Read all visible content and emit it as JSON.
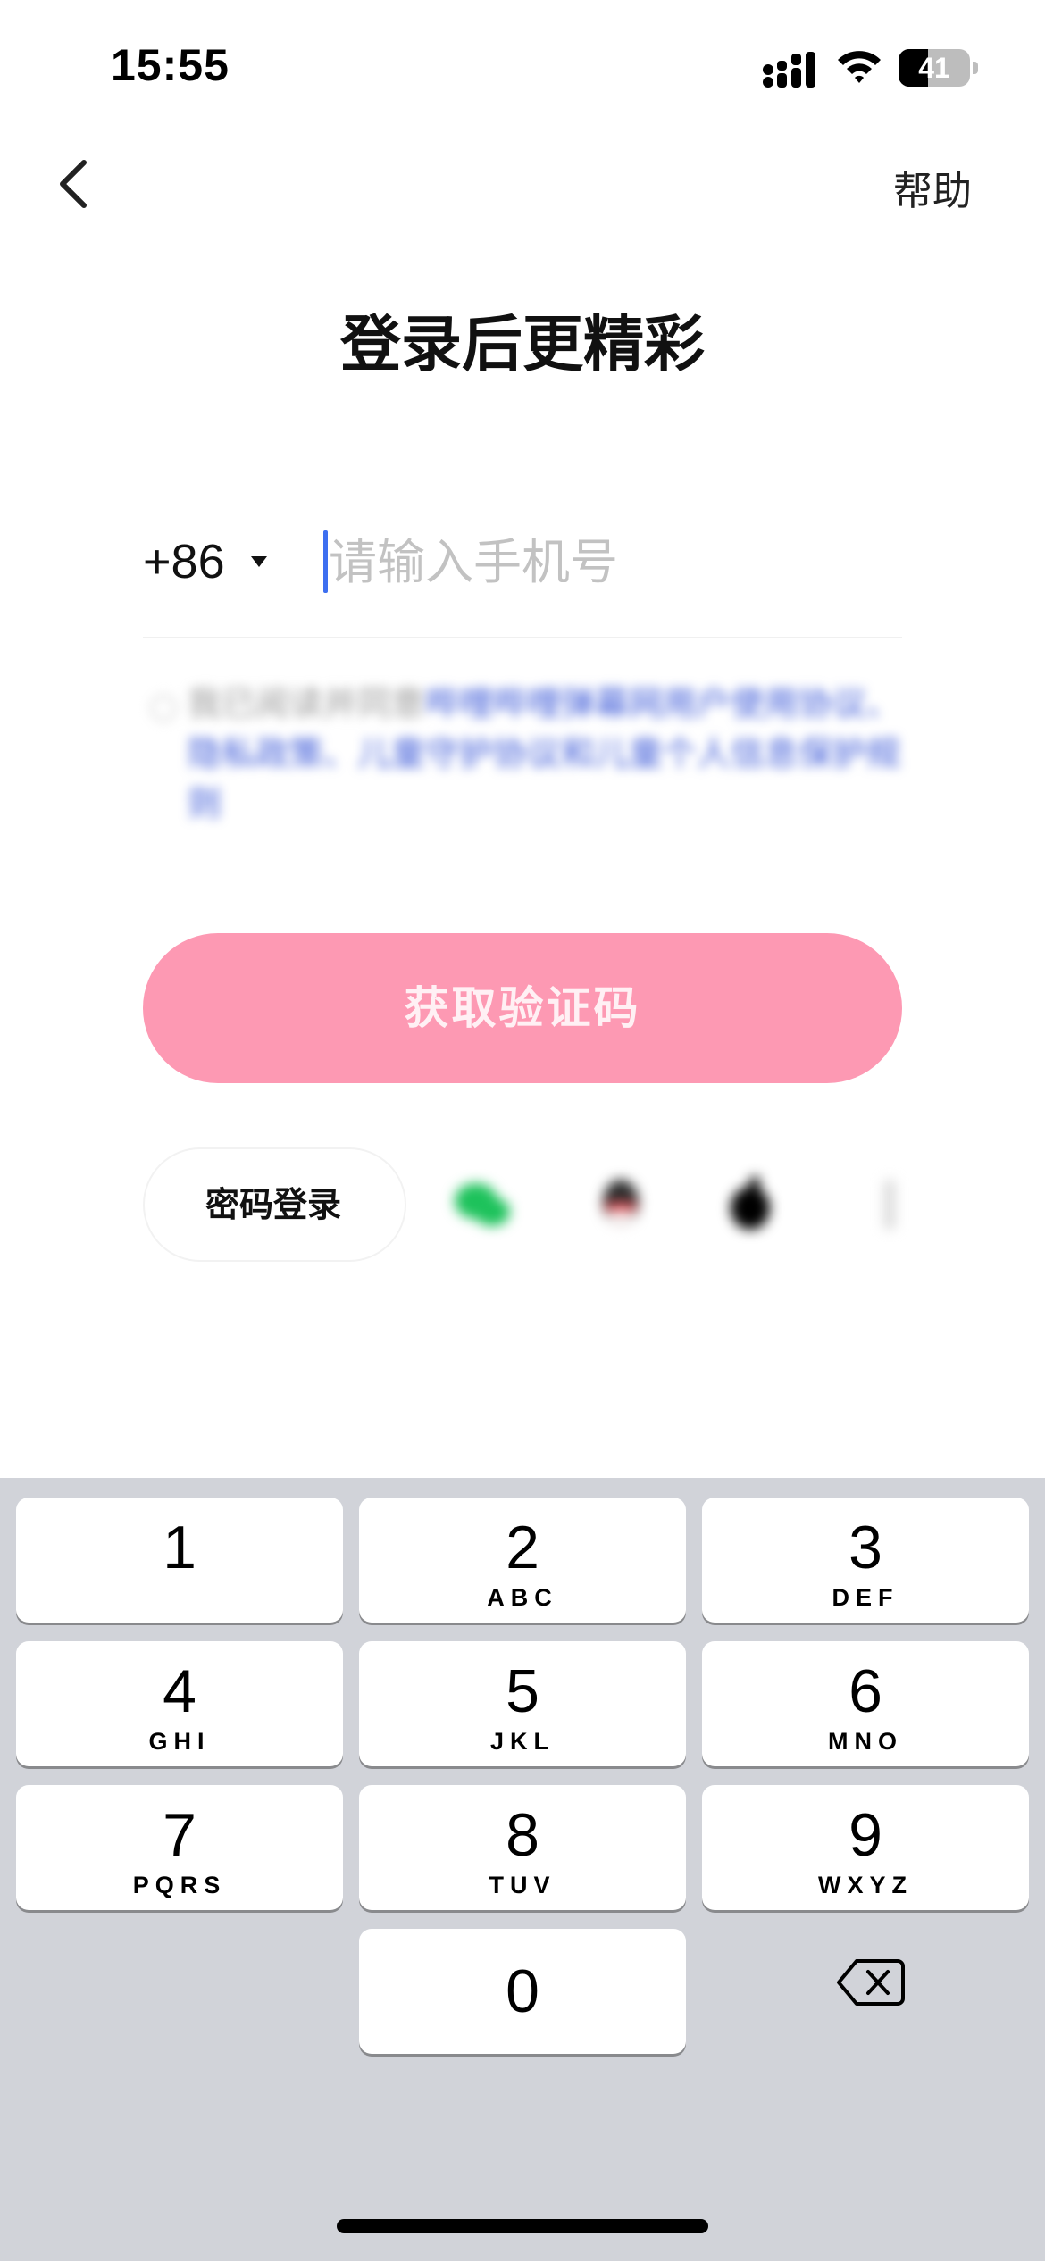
{
  "status_bar": {
    "time": "15:55",
    "battery": "41",
    "battery_level": 0.41
  },
  "nav": {
    "help": "帮助"
  },
  "title": "登录后更精彩",
  "phone": {
    "country_code": "+86",
    "placeholder": "请输入手机号",
    "value": ""
  },
  "agreement": {
    "text_prefix": "我已阅读并同意",
    "links": "哔哩哔哩弹幕网用户使用协议、隐私政策、儿童守护协议和儿童个人信息保护规则"
  },
  "primary_button": "获取验证码",
  "alt_login": {
    "password_login": "密码登录"
  },
  "social_icons": [
    "wechat-icon",
    "qq-icon",
    "apple-icon",
    "more-icon"
  ],
  "colors": {
    "accent_pink": "#fd99b3",
    "caret_blue": "#3d6ff0",
    "keyboard_bg": "#d1d3d9"
  },
  "keypad": [
    {
      "digit": "1",
      "letters": ""
    },
    {
      "digit": "2",
      "letters": "ABC"
    },
    {
      "digit": "3",
      "letters": "DEF"
    },
    {
      "digit": "4",
      "letters": "GHI"
    },
    {
      "digit": "5",
      "letters": "JKL"
    },
    {
      "digit": "6",
      "letters": "MNO"
    },
    {
      "digit": "7",
      "letters": "PQRS"
    },
    {
      "digit": "8",
      "letters": "TUV"
    },
    {
      "digit": "9",
      "letters": "WXYZ"
    },
    {
      "digit": "0",
      "letters": ""
    }
  ]
}
